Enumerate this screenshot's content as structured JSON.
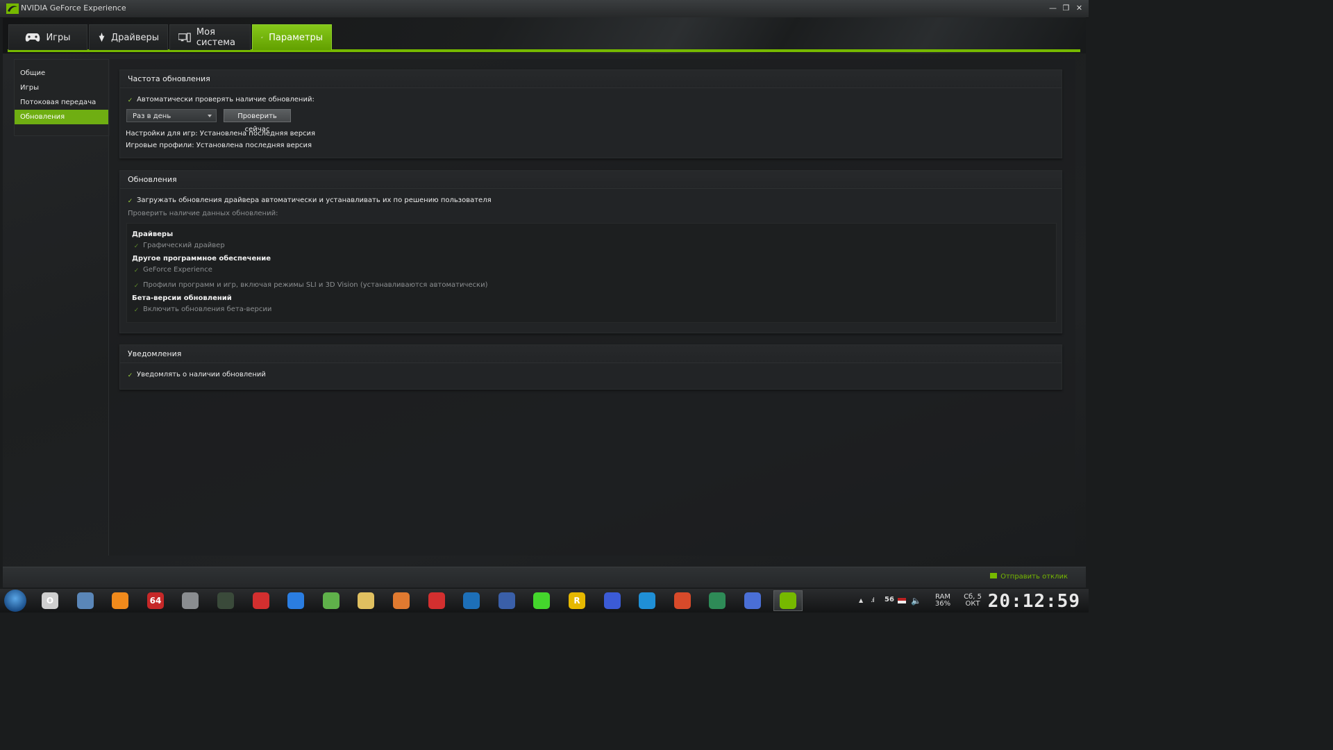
{
  "window": {
    "title": "NVIDIA GeForce Experience"
  },
  "tabs": [
    {
      "label": "Игры",
      "icon": "gamepad-icon"
    },
    {
      "label": "Драйверы",
      "icon": "driver-icon"
    },
    {
      "label": "Моя система",
      "icon": "computer-icon"
    },
    {
      "label": "Параметры",
      "icon": "gear-icon",
      "active": true
    }
  ],
  "sidebar": {
    "items": [
      {
        "label": "Общие"
      },
      {
        "label": "Игры"
      },
      {
        "label": "Потоковая передача"
      },
      {
        "label": "Обновления",
        "active": true
      }
    ]
  },
  "update_frequency": {
    "title": "Частота обновления",
    "auto_check_label": "Автоматически проверять наличие обновлений:",
    "auto_check_checked": true,
    "frequency_value": "Раз в день",
    "check_now_label": "Проверить сейчас",
    "game_settings_status": "Настройки для игр: Установлена последняя версия",
    "game_profiles_status": "Игровые профили: Установлена последняя версия"
  },
  "updates": {
    "title": "Обновления",
    "auto_download_label": "Загружать обновления драйвера автоматически и устанавливать их по решению пользователя",
    "auto_download_checked": true,
    "check_for_label": "Проверить наличие данных обновлений:",
    "drivers_heading": "Драйверы",
    "graphics_driver_label": "Графический драйвер",
    "other_software_heading": "Другое программное обеспечение",
    "geforce_experience_label": "GeForce Experience",
    "profiles_label": "Профили программ и игр, включая режимы SLI и 3D Vision (устанавливаются автоматически)",
    "beta_heading": "Бета-версии обновлений",
    "beta_label": "Включить обновления бета-версии"
  },
  "notifications": {
    "title": "Уведомления",
    "notify_label": "Уведомлять о наличии обновлений",
    "notify_checked": true
  },
  "statusbar": {
    "feedback_label": "Отправить отклик"
  },
  "taskbar": {
    "apps": [
      {
        "name": "opera-icon",
        "glyph": "O",
        "color": "#cfcfcf"
      },
      {
        "name": "monitor-app-icon",
        "glyph": "",
        "color": "#5a86b8"
      },
      {
        "name": "avast-icon",
        "glyph": "",
        "color": "#f08a1c"
      },
      {
        "name": "aida64-icon",
        "glyph": "64",
        "color": "#c62828"
      },
      {
        "name": "steam-icon",
        "glyph": "",
        "color": "#8a8d90"
      },
      {
        "name": "hwmonitor-icon",
        "glyph": "",
        "color": "#3a4a3a"
      },
      {
        "name": "record-icon",
        "glyph": "",
        "color": "#d32f2f"
      },
      {
        "name": "lightning-app-icon",
        "glyph": "",
        "color": "#2a7de1"
      },
      {
        "name": "utorrent-icon",
        "glyph": "",
        "color": "#5fb14a"
      },
      {
        "name": "file-explorer-icon",
        "glyph": "",
        "color": "#e0c060"
      },
      {
        "name": "media-player-classic-icon",
        "glyph": "",
        "color": "#e07a30"
      },
      {
        "name": "youtube-player-icon",
        "glyph": "",
        "color": "#d32f2f"
      },
      {
        "name": "video-player-icon",
        "glyph": "",
        "color": "#1d6fb8"
      },
      {
        "name": "globe-app-icon",
        "glyph": "",
        "color": "#3a5fa8"
      },
      {
        "name": "razer-cortex-icon",
        "glyph": "",
        "color": "#44d62c"
      },
      {
        "name": "rockstar-icon",
        "glyph": "R",
        "color": "#e6b800"
      },
      {
        "name": "origin-icon",
        "glyph": "",
        "color": "#3b5bd6"
      },
      {
        "name": "ccleaner-icon",
        "glyph": "",
        "color": "#1f8fd6"
      },
      {
        "name": "cpuz-icon",
        "glyph": "",
        "color": "#d84a2a"
      },
      {
        "name": "radeon-icon",
        "glyph": "",
        "color": "#2e8b57"
      },
      {
        "name": "paint-icon",
        "glyph": "",
        "color": "#4a6fd6"
      },
      {
        "name": "nvidia-geforce-icon",
        "glyph": "",
        "color": "#76b900",
        "active": true
      }
    ],
    "tray": {
      "signal_value": "56",
      "ram_label": "RAM",
      "ram_value": "36%",
      "date_day": "Сб, 5",
      "date_month": "ОКТ",
      "time": "20:12:59"
    }
  },
  "colors": {
    "accent": "#76b900",
    "background": "#1a1c1d"
  }
}
